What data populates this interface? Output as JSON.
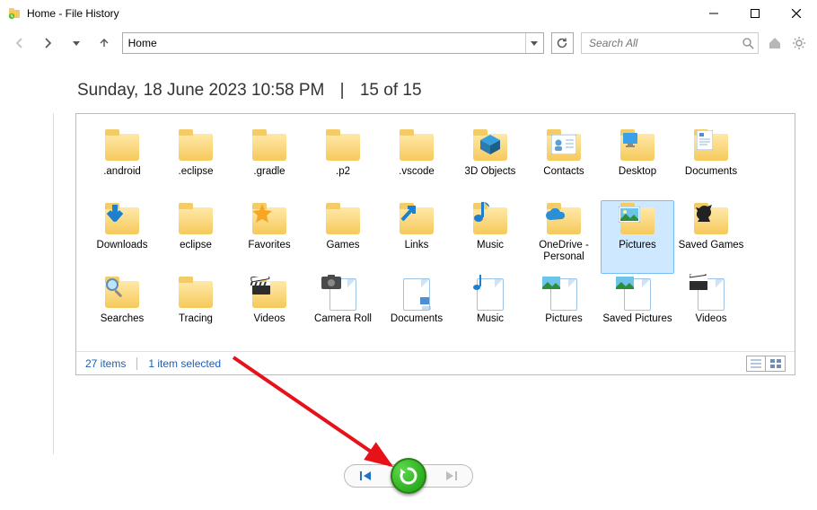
{
  "window": {
    "title": "Home - File History"
  },
  "toolbar": {
    "address": "Home",
    "search_placeholder": "Search All"
  },
  "heading": {
    "timestamp": "Sunday, 18 June 2023 10:58 PM",
    "position": "15 of 15"
  },
  "items": [
    {
      "label": ".android",
      "kind": "folder"
    },
    {
      "label": ".eclipse",
      "kind": "folder"
    },
    {
      "label": ".gradle",
      "kind": "folder"
    },
    {
      "label": ".p2",
      "kind": "folder"
    },
    {
      "label": ".vscode",
      "kind": "folder"
    },
    {
      "label": "3D Objects",
      "kind": "folder",
      "overlay": "cube3d"
    },
    {
      "label": "Contacts",
      "kind": "folder",
      "overlay": "contact"
    },
    {
      "label": "Desktop",
      "kind": "folder",
      "overlay": "desk"
    },
    {
      "label": "Documents",
      "kind": "folder",
      "overlay": "doc"
    },
    {
      "label": "Downloads",
      "kind": "folder",
      "overlay": "down"
    },
    {
      "label": "eclipse",
      "kind": "folder"
    },
    {
      "label": "Favorites",
      "kind": "folder",
      "overlay": "star"
    },
    {
      "label": "Games",
      "kind": "folder"
    },
    {
      "label": "Links",
      "kind": "folder",
      "overlay": "link"
    },
    {
      "label": "Music",
      "kind": "folder",
      "overlay": "note"
    },
    {
      "label": "OneDrive - Personal",
      "kind": "folder",
      "overlay": "cloud"
    },
    {
      "label": "Pictures",
      "kind": "folder",
      "overlay": "pic",
      "selected": true
    },
    {
      "label": "Saved Games",
      "kind": "folder",
      "overlay": "chess"
    },
    {
      "label": "Searches",
      "kind": "folder",
      "overlay": "mag"
    },
    {
      "label": "Tracing",
      "kind": "folder"
    },
    {
      "label": "Videos",
      "kind": "folder",
      "overlay": "clap"
    },
    {
      "label": "Camera Roll",
      "kind": "file",
      "overlay": "cam"
    },
    {
      "label": "Documents",
      "kind": "file",
      "overlay": "docf"
    },
    {
      "label": "Music",
      "kind": "file",
      "overlay": "notef"
    },
    {
      "label": "Pictures",
      "kind": "file",
      "overlay": "picf"
    },
    {
      "label": "Saved Pictures",
      "kind": "file",
      "overlay": "picf"
    },
    {
      "label": "Videos",
      "kind": "file",
      "overlay": "clapf"
    }
  ],
  "status": {
    "count": "27 items",
    "selected": "1 item selected"
  }
}
